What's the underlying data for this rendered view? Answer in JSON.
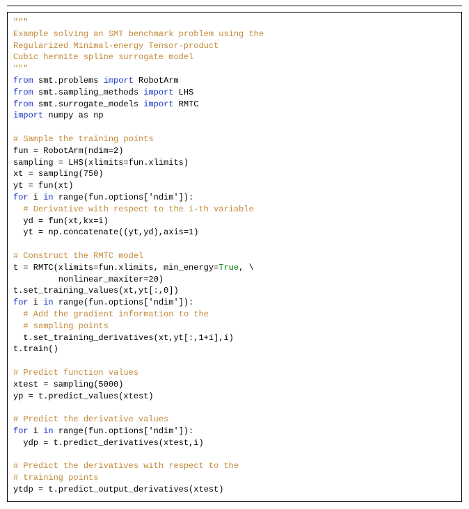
{
  "code": {
    "lines": [
      [
        [
          "str",
          "\"\"\""
        ]
      ],
      [
        [
          "str",
          "Example solving an SMT benchmark problem using the"
        ]
      ],
      [
        [
          "str",
          "Regularized Minimal-energy Tensor-product"
        ]
      ],
      [
        [
          "str",
          "Cubic hermite spline surrogate model"
        ]
      ],
      [
        [
          "str",
          "\"\"\""
        ]
      ],
      [
        [
          "kw",
          "from"
        ],
        [
          "id",
          " smt.problems "
        ],
        [
          "kw",
          "import"
        ],
        [
          "id",
          " RobotArm"
        ]
      ],
      [
        [
          "kw",
          "from"
        ],
        [
          "id",
          " smt.sampling_methods "
        ],
        [
          "kw",
          "import"
        ],
        [
          "id",
          " LHS"
        ]
      ],
      [
        [
          "kw",
          "from"
        ],
        [
          "id",
          " smt.surrogate_models "
        ],
        [
          "kw",
          "import"
        ],
        [
          "id",
          " RMTC"
        ]
      ],
      [
        [
          "kw",
          "import"
        ],
        [
          "id",
          " numpy as np"
        ]
      ],
      [
        [
          "id",
          ""
        ]
      ],
      [
        [
          "str",
          "# Sample the training points"
        ]
      ],
      [
        [
          "id",
          "fun = RobotArm(ndim=2)"
        ]
      ],
      [
        [
          "id",
          "sampling = LHS(xlimits=fun.xlimits)"
        ]
      ],
      [
        [
          "id",
          "xt = sampling(750)"
        ]
      ],
      [
        [
          "id",
          "yt = fun(xt)"
        ]
      ],
      [
        [
          "kw",
          "for"
        ],
        [
          "id",
          " i "
        ],
        [
          "kw",
          "in"
        ],
        [
          "id",
          " range(fun.options['ndim']):"
        ]
      ],
      [
        [
          "id",
          "  "
        ],
        [
          "str",
          "# Derivative with respect to the i-th variable"
        ]
      ],
      [
        [
          "id",
          "  yd = fun(xt,kx=i)"
        ]
      ],
      [
        [
          "id",
          "  yt = np.concatenate((yt,yd),axis=1)"
        ]
      ],
      [
        [
          "id",
          ""
        ]
      ],
      [
        [
          "str",
          "# Construct the RMTC model"
        ]
      ],
      [
        [
          "id",
          "t = RMTC(xlimits=fun.xlimits, min_energy="
        ],
        [
          "bool",
          "True"
        ],
        [
          "id",
          ", \\"
        ]
      ],
      [
        [
          "id",
          "         nonlinear_maxiter=20)"
        ]
      ],
      [
        [
          "id",
          "t.set_training_values(xt,yt[:,0])"
        ]
      ],
      [
        [
          "kw",
          "for"
        ],
        [
          "id",
          " i "
        ],
        [
          "kw",
          "in"
        ],
        [
          "id",
          " range(fun.options['ndim']):"
        ]
      ],
      [
        [
          "id",
          "  "
        ],
        [
          "str",
          "# Add the gradient information to the"
        ]
      ],
      [
        [
          "id",
          "  "
        ],
        [
          "str",
          "# sampling points"
        ]
      ],
      [
        [
          "id",
          "  t.set_training_derivatives(xt,yt[:,1+i],i)"
        ]
      ],
      [
        [
          "id",
          "t.train()"
        ]
      ],
      [
        [
          "id",
          ""
        ]
      ],
      [
        [
          "str",
          "# Predict function values"
        ]
      ],
      [
        [
          "id",
          "xtest = sampling(5000)"
        ]
      ],
      [
        [
          "id",
          "yp = t.predict_values(xtest)"
        ]
      ],
      [
        [
          "id",
          ""
        ]
      ],
      [
        [
          "str",
          "# Predict the derivative values"
        ]
      ],
      [
        [
          "kw",
          "for"
        ],
        [
          "id",
          " i "
        ],
        [
          "kw",
          "in"
        ],
        [
          "id",
          " range(fun.options['ndim']):"
        ]
      ],
      [
        [
          "id",
          "  ydp = t.predict_derivatives(xtest,i)"
        ]
      ],
      [
        [
          "id",
          ""
        ]
      ],
      [
        [
          "str",
          "# Predict the derivatives with respect to the"
        ]
      ],
      [
        [
          "str",
          "# training points"
        ]
      ],
      [
        [
          "id",
          "ytdp = t.predict_output_derivatives(xtest)"
        ]
      ]
    ]
  }
}
